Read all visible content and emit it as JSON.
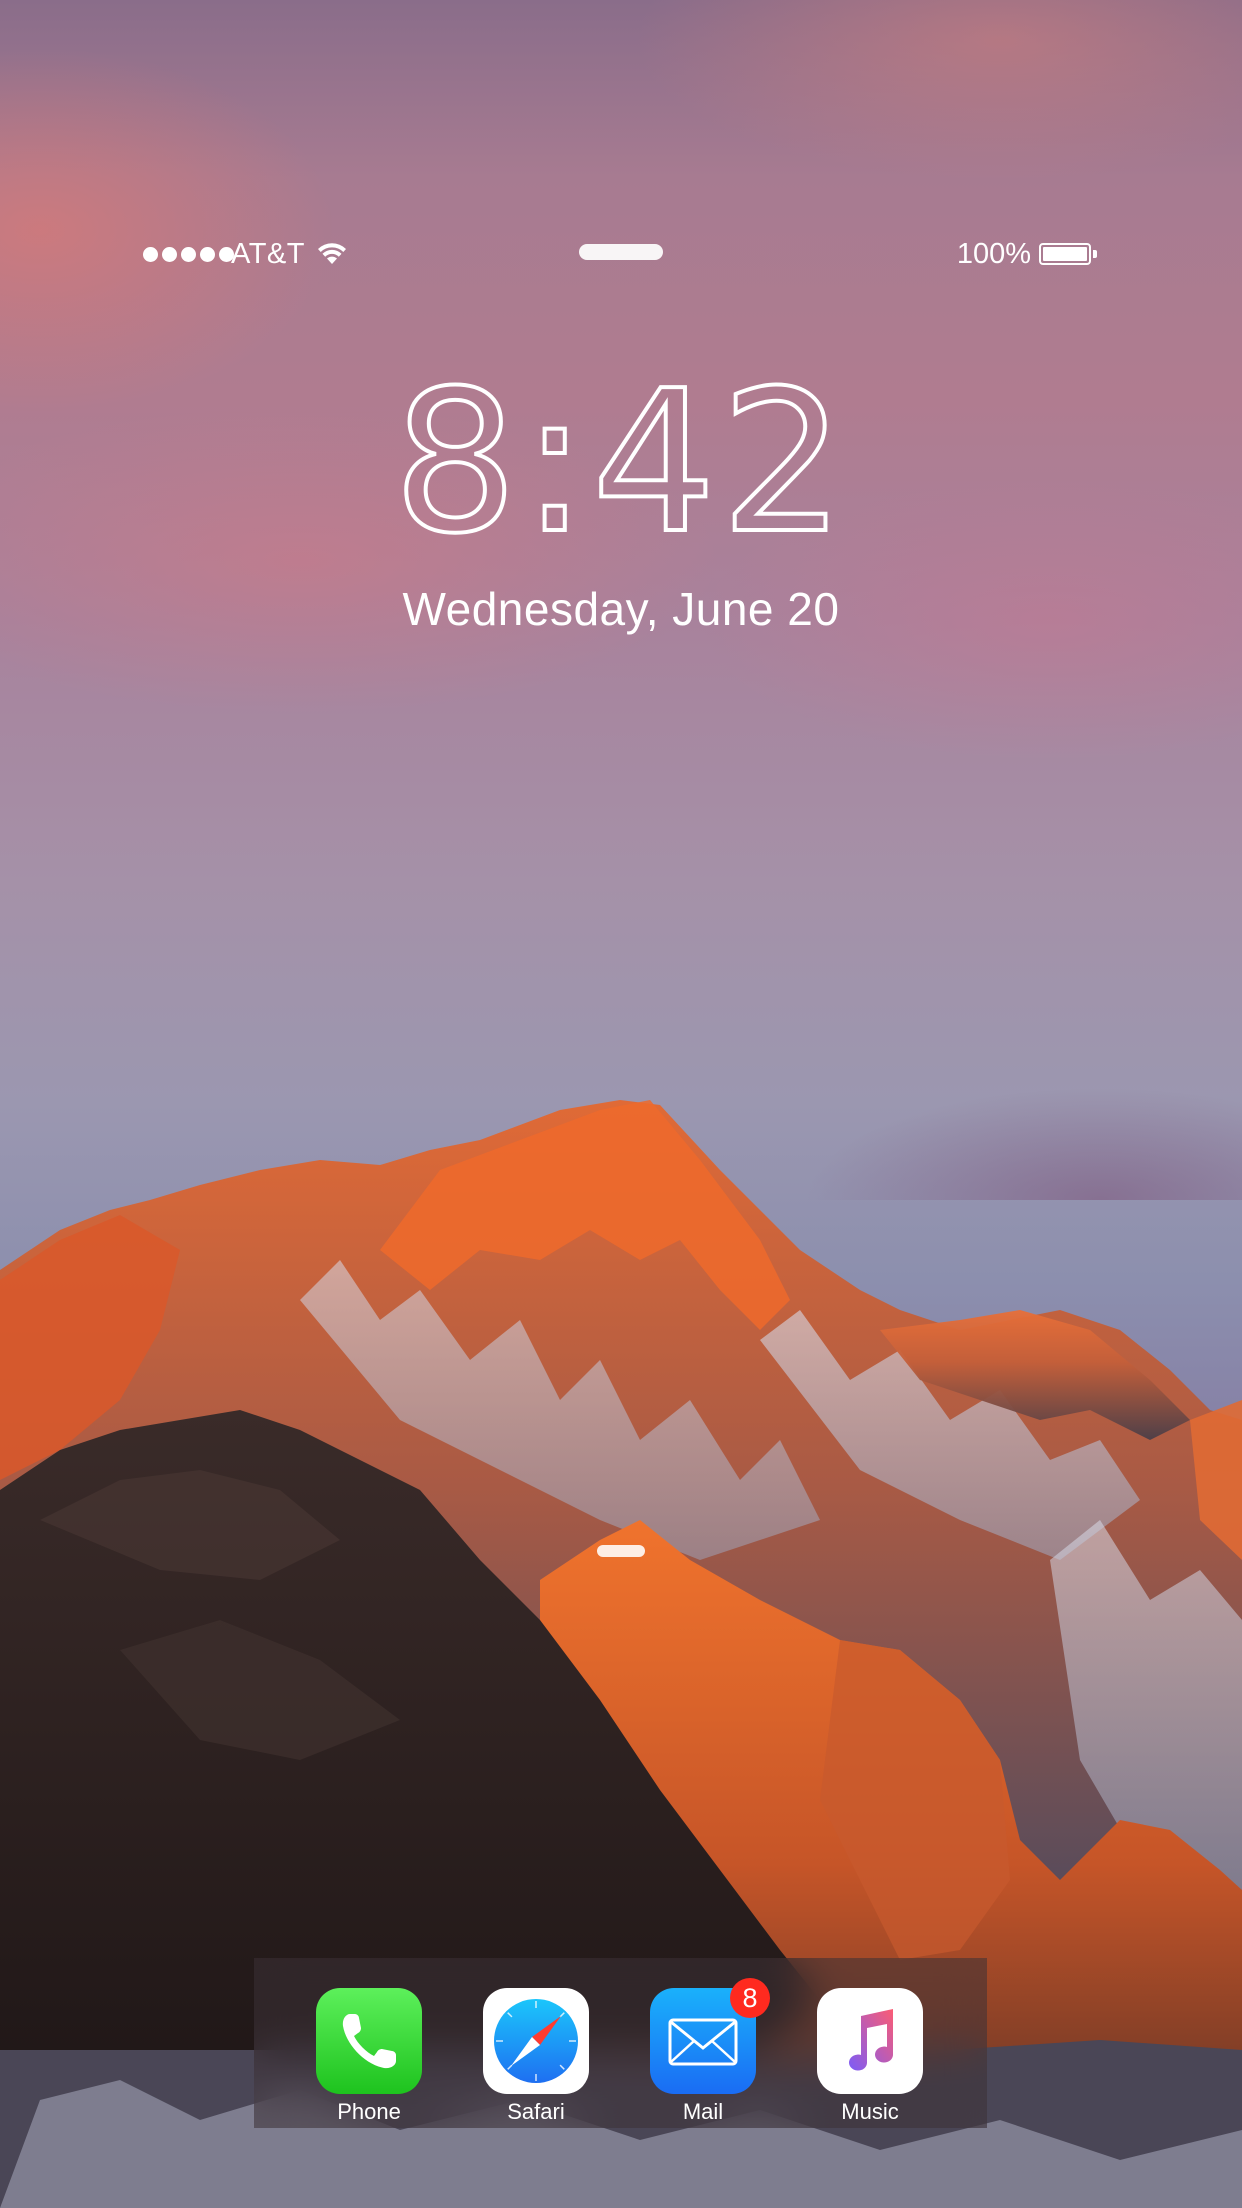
{
  "status_bar": {
    "signal_bars_filled": 5,
    "carrier": "AT&T",
    "wifi_icon": "wifi-icon",
    "battery_percent_label": "100%",
    "battery_level": 1.0
  },
  "lock_screen": {
    "time": "8:42",
    "date": "Wednesday, June 20"
  },
  "dock": {
    "apps": [
      {
        "label": "Phone",
        "icon": "phone-icon",
        "badge": ""
      },
      {
        "label": "Safari",
        "icon": "safari-icon",
        "badge": ""
      },
      {
        "label": "Mail",
        "icon": "mail-icon",
        "badge": "8"
      },
      {
        "label": "Music",
        "icon": "music-icon",
        "badge": ""
      }
    ]
  },
  "colors": {
    "phone_green": "#1ec31e",
    "mail_blue": "#1a6cf4",
    "badge_red": "#ff2a1f",
    "music_gradient_start": "#fb5c74",
    "music_gradient_end": "#7c5cf7"
  }
}
